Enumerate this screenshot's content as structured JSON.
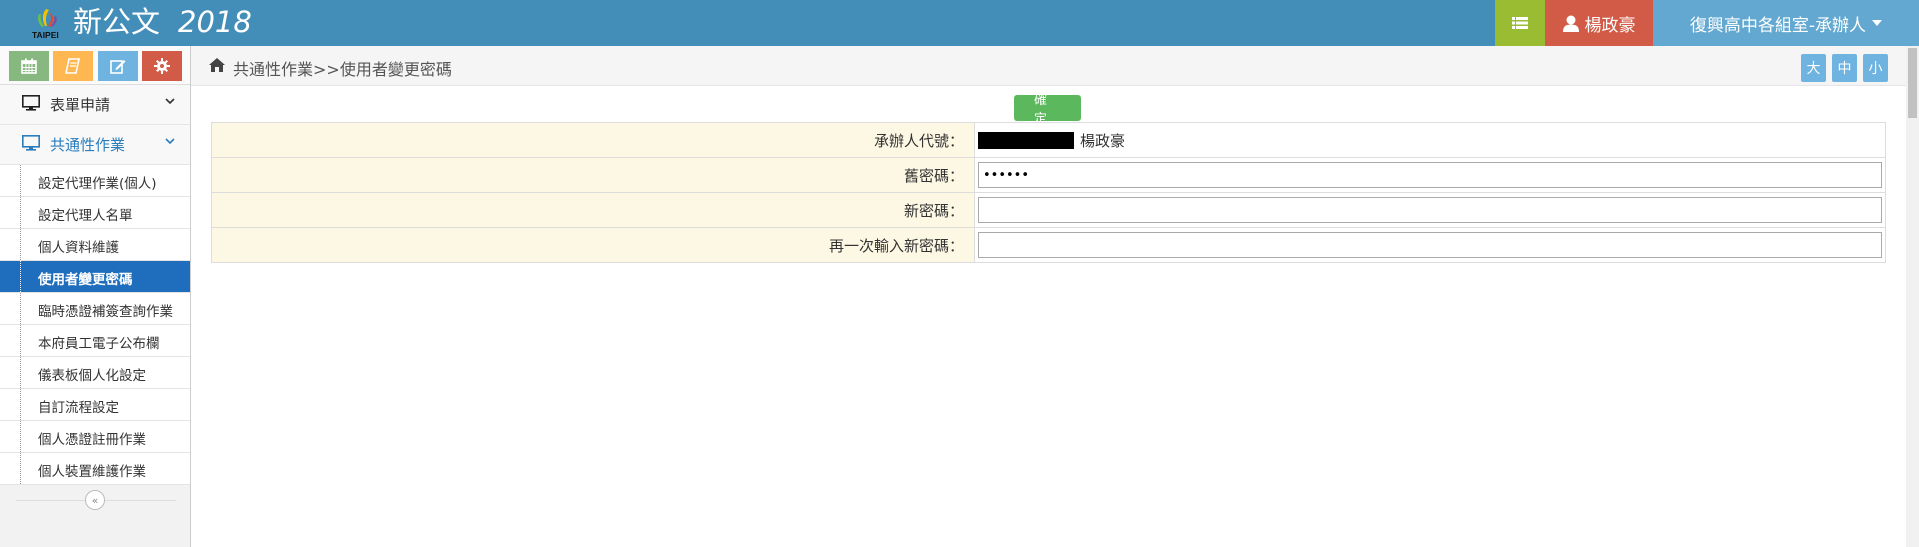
{
  "header": {
    "app_name": "新公文",
    "year": "2018",
    "logo_text": "TAIPEI",
    "user_name": "楊政豪",
    "unit_label": "復興高中各組室-承辦人",
    "list_icon": "list-icon",
    "user_icon": "user-icon",
    "colors": {
      "bar": "#438eb9",
      "list_btn": "#9abc32",
      "user_btn": "#d15b47",
      "unit_btn": "#62a8d1"
    }
  },
  "sidebar": {
    "shortcuts": [
      {
        "icon": "calendar-icon",
        "color": "#87b87f"
      },
      {
        "icon": "book-icon",
        "color": "#ffb752"
      },
      {
        "icon": "edit-icon",
        "color": "#6fb3e0"
      },
      {
        "icon": "gear-icon",
        "color": "#d15b47"
      }
    ],
    "menus": [
      {
        "label": "表單申請",
        "icon": "desktop-icon"
      },
      {
        "label": "共通性作業",
        "icon": "desktop-icon"
      }
    ],
    "sub_items": [
      {
        "label": "設定代理作業(個人)"
      },
      {
        "label": "設定代理人名單"
      },
      {
        "label": "個人資料維護"
      },
      {
        "label": "使用者變更密碼"
      },
      {
        "label": "臨時憑證補簽查詢作業"
      },
      {
        "label": "本府員工電子公布欄"
      },
      {
        "label": "儀表板個人化設定"
      },
      {
        "label": "自訂流程設定"
      },
      {
        "label": "個人憑證註冊作業"
      },
      {
        "label": "個人裝置維護作業"
      }
    ],
    "collapse_symbol": "«"
  },
  "breadcrumb": {
    "text": "共通性作業>>使用者變更密碼",
    "font_sizes": [
      "大",
      "中",
      "小"
    ]
  },
  "form": {
    "confirm_label": "確定",
    "rows": [
      {
        "label": "承辦人代號："
      },
      {
        "label": "舊密碼："
      },
      {
        "label": "新密碼："
      },
      {
        "label": "再一次輸入新密碼："
      }
    ],
    "owner_name": "楊政豪",
    "old_password_value": "••••••",
    "new_password_value": "",
    "confirm_password_value": ""
  }
}
